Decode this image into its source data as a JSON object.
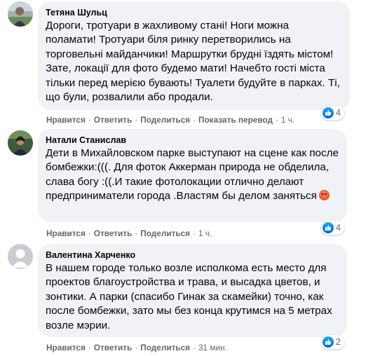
{
  "comments": [
    {
      "author": "Тетяна Шульц",
      "text": "Дороги, тротуари в жахливому стані! Ноги можна поламати! Тротуари біля ринку перетворились на торговельні майданчики! Маршрутки брудні їздять містом! Зате, локації для фото будемо мати! Начебто гості міста тільки перед мерією бувають! Туалети будуйте в парках. Ті, що були, розвалили або продали.",
      "reaction_count": "4",
      "actions": {
        "like": "Нравится",
        "reply": "Ответить",
        "share": "Поделиться",
        "translate": "Показать перевод",
        "time": "1 ч."
      }
    },
    {
      "author": "Натали Станислав",
      "text": "Дети в Михайловском парке выступают на сцене как после бомбежки:(((. Для фоток Аккерман природа не обделила, слава богу :((.И такие фотолокации отлично делают предприниматели города .Властям бы делом заняться",
      "emoji": "angry-face",
      "reaction_count": "4",
      "actions": {
        "like": "Нравится",
        "reply": "Ответить",
        "share": "Поделиться",
        "time": "1 ч."
      }
    },
    {
      "author": "Валентина Харченко",
      "text": "В нашем городе только возле исполкома есть место для проектов благоустройства и трава, и высадка цветов, и зонтики. А парки (спасибо Гинак за скамейки) точно, как после бомбежки, зато мы без конца крутимся на 5 метрах возле мэрии.",
      "reaction_count": "2",
      "actions": {
        "like": "Нравится",
        "reply": "Ответить",
        "share": "Поделиться",
        "time": "31 мин."
      }
    }
  ],
  "separator": "·",
  "colors": {
    "bubble": "#f0f2f5",
    "meta": "#65676b",
    "like_blue": "#1877f2",
    "text": "#050505"
  },
  "icons": {
    "reaction": "like-icon",
    "avatar": "profile-photo"
  }
}
